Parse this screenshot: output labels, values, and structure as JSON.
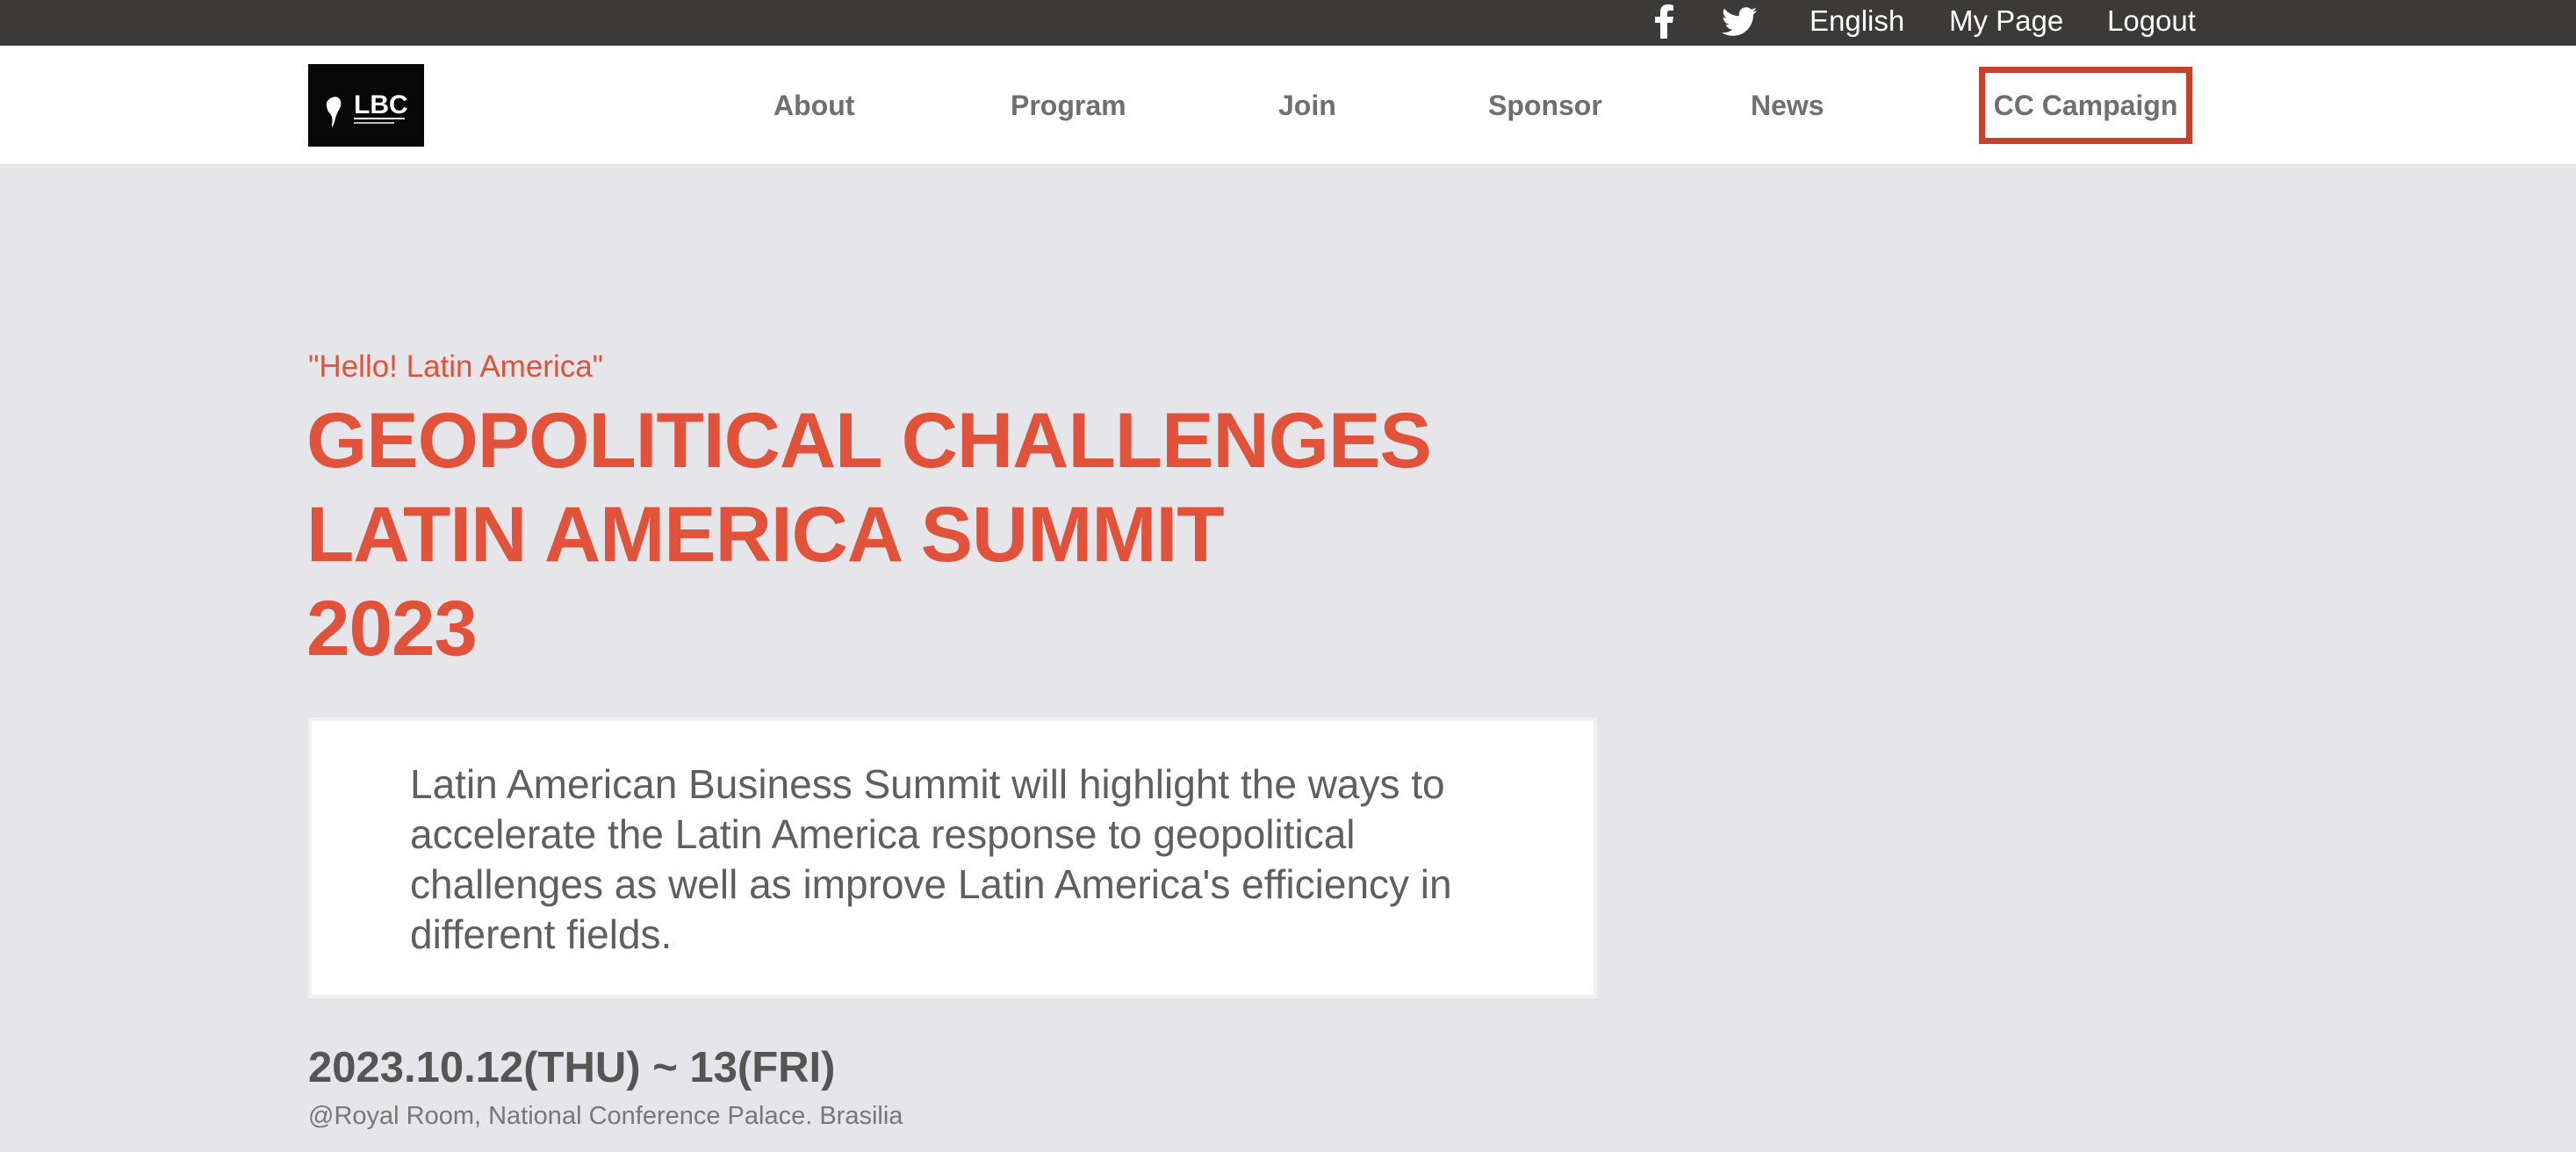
{
  "topbar": {
    "social": [
      "facebook-icon",
      "twitter-icon"
    ],
    "language": "English",
    "my_page": "My Page",
    "logout": "Logout"
  },
  "header": {
    "logo_text": "LBC",
    "nav": [
      {
        "label": "About"
      },
      {
        "label": "Program"
      },
      {
        "label": "Join"
      },
      {
        "label": "Sponsor"
      },
      {
        "label": "News"
      }
    ],
    "cta": "CC Campaign"
  },
  "hero": {
    "eyebrow": "\"Hello! Latin America\"",
    "title_lines": [
      "GEOPOLITICAL CHALLENGES",
      "LATIN AMERICA SUMMIT",
      "2023"
    ],
    "description": "Latin American Business Summit will highlight the ways to accelerate the Latin America response to geopolitical challenges as well as improve Latin America's efficiency in different fields.",
    "date": "2023.10.12(THU) ~ 13(FRI)",
    "venue": "@Royal Room, National Conference Palace. Brasilia"
  },
  "colors": {
    "accent": "#e0533a",
    "cta_border": "#c4412b",
    "topbar_bg": "#3b3a39",
    "page_bg": "#e6e5ea"
  }
}
